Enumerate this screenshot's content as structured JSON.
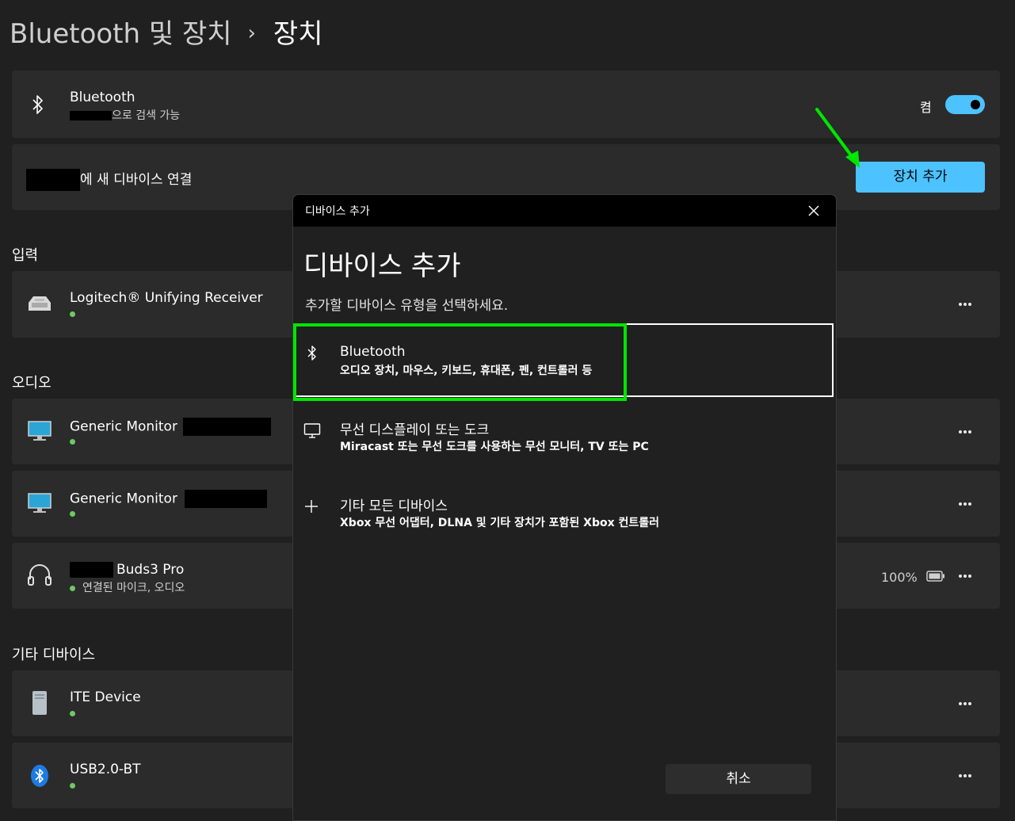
{
  "breadcrumb": {
    "parent": "Bluetooth 및 장치",
    "separator": "›",
    "current": "장치"
  },
  "bluetooth_card": {
    "title": "Bluetooth",
    "subtitle_suffix": "으로 검색 가능",
    "toggle_label": "켬",
    "toggle_on": true
  },
  "connect_card": {
    "text_suffix": "에 새 디바이스 연결",
    "button_label": "장치 추가"
  },
  "sections": {
    "input": "입력",
    "audio": "오디오",
    "other": "기타 디바이스"
  },
  "devices": {
    "logitech": {
      "name": "Logitech® Unifying Receiver"
    },
    "monitor1": {
      "name": "Generic Monitor"
    },
    "monitor2": {
      "name": "Generic Monitor"
    },
    "buds": {
      "name": "Buds3 Pro",
      "status": "연결된 마이크, 오디오",
      "battery": "100%"
    },
    "ite": {
      "name": "ITE Device"
    },
    "usbbt": {
      "name": "USB2.0-BT"
    }
  },
  "dialog": {
    "titlebar": "디바이스 추가",
    "heading": "디바이스 추가",
    "subheading": "추가할 디바이스 유형을 선택하세요.",
    "options": [
      {
        "title": "Bluetooth",
        "desc": "오디오 장치, 마우스, 키보드, 휴대폰, 펜, 컨트롤러 등",
        "icon": "bluetooth-icon"
      },
      {
        "title": "무선 디스플레이 또는 도크",
        "desc": "Miracast 또는 무선 도크를 사용하는 무선 모니터, TV 또는 PC",
        "icon": "monitor-icon"
      },
      {
        "title": "기타 모든 디바이스",
        "desc": "Xbox 무선 어댑터, DLNA 및 기타 장치가 포함된 Xbox 컨트롤러",
        "icon": "plus-icon"
      }
    ],
    "cancel": "취소"
  },
  "colors": {
    "accent": "#4cc2ff",
    "highlight": "#00e600",
    "status_dot": "#6ccb5f",
    "background": "#202020",
    "card": "#2b2b2b"
  }
}
